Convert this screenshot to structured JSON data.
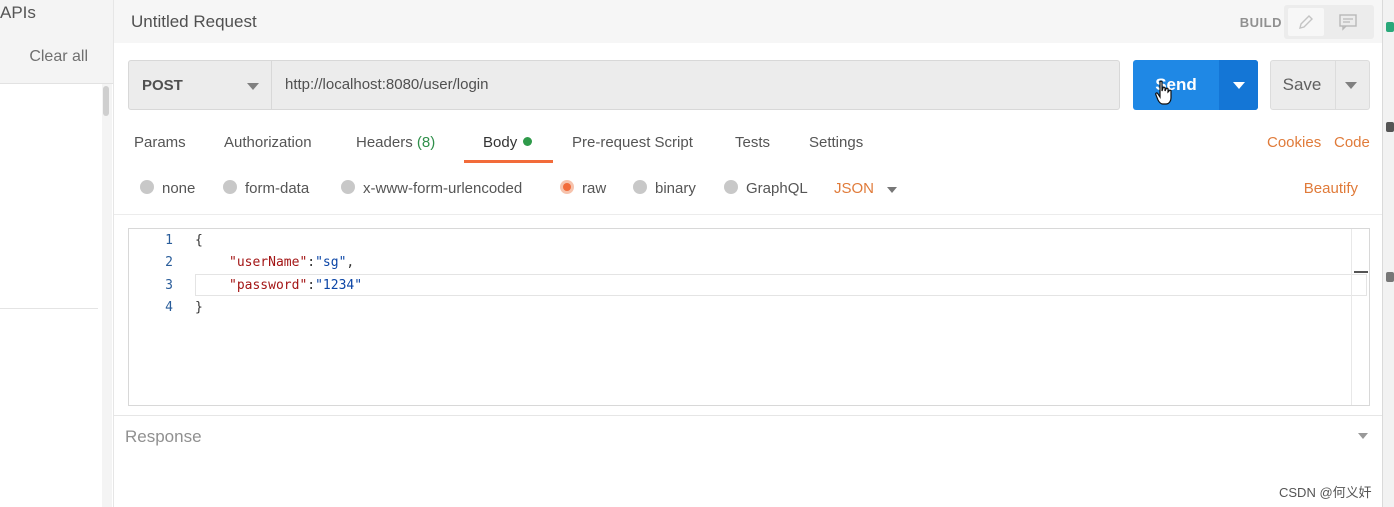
{
  "sidebar": {
    "apis_label": "APIs",
    "clear_all_label": "Clear all"
  },
  "request": {
    "title": "Untitled Request",
    "mode_label": "BUILD",
    "method": "POST",
    "url": "http://localhost:8080/user/login",
    "send_label": "Send",
    "save_label": "Save"
  },
  "tabs": [
    {
      "label": "Params"
    },
    {
      "label": "Authorization"
    },
    {
      "label": "Headers",
      "count": "(8)"
    },
    {
      "label": "Body"
    },
    {
      "label": "Pre-request Script"
    },
    {
      "label": "Tests"
    },
    {
      "label": "Settings"
    }
  ],
  "links": {
    "cookies": "Cookies",
    "code": "Code"
  },
  "body_types": [
    {
      "label": "none",
      "selected": false
    },
    {
      "label": "form-data",
      "selected": false
    },
    {
      "label": "x-www-form-urlencoded",
      "selected": false
    },
    {
      "label": "raw",
      "selected": true
    },
    {
      "label": "binary",
      "selected": false
    },
    {
      "label": "GraphQL",
      "selected": false
    }
  ],
  "raw_format": "JSON",
  "beautify_label": "Beautify",
  "editor": {
    "line_numbers": [
      "1",
      "2",
      "3",
      "4"
    ],
    "open_brace": "{",
    "close_brace": "}",
    "key1": "\"userName\"",
    "val1": "\"sg\"",
    "key2": "\"password\"",
    "val2": "\"1234\"",
    "colon": ":",
    "comma": ","
  },
  "response_label": "Response",
  "watermark": "CSDN @何义奸",
  "colors": {
    "accent": "#f26b3a",
    "send": "#1f88e5",
    "ok_dot": "#2f9a4a"
  }
}
